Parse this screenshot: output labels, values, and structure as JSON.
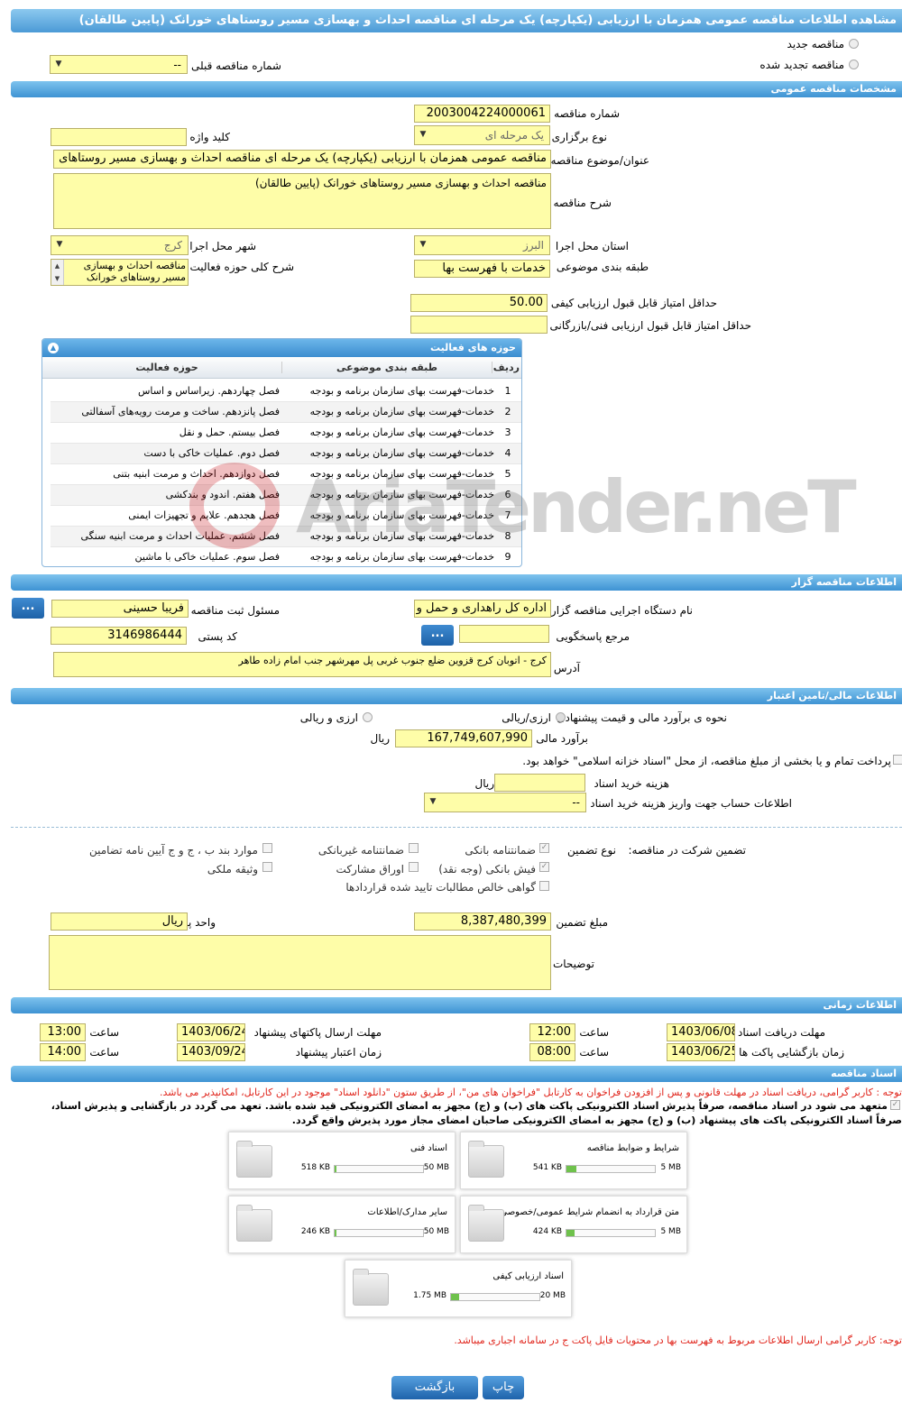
{
  "page_title": "مشاهده اطلاعات مناقصه عمومی همزمان با ارزیابی (یکپارچه) یک مرحله ای مناقصه احداث و بهسازی مسیر روستاهای خورانک (پایین طالقان)",
  "tender_type": {
    "new_label": "مناقصه جدید",
    "renewed_label": "مناقصه تجدید شده",
    "prev_label": "شماره مناقصه قبلی",
    "prev_value": "--"
  },
  "general": {
    "header": "مشخصات مناقصه عمومی",
    "number_label": "شماره مناقصه",
    "number": "2003004224000061",
    "type_label": "نوع برگزاری",
    "type": "یک مرحله ای",
    "keyword_label": "کلید واژه",
    "keyword": "",
    "title_label": "عنوان/موضوع مناقصه",
    "title": "مناقصه عمومی همزمان با ارزیابی (یکپارچه) یک مرحله ای مناقصه احداث و بهسازی مسیر روستاهای",
    "desc_label": "شرح مناقصه",
    "desc": "مناقصه احداث و بهسازی مسیر روستاهای خورانک (پایین طالقان)",
    "province_label": "استان محل اجرا",
    "province": "البرز",
    "city_label": "شهر محل اجرا",
    "city": "کرج",
    "category_label": "طبقه بندی موضوعی",
    "category": "خدمات با فهرست بها",
    "scope_label": "شرح کلی حوزه فعالیت",
    "scope_line1": "مناقصه احداث و بهسازی",
    "scope_line2": "مسیر روستاهای خورانک",
    "min_quality_label": "حداقل امتیاز قابل قبول ارزیابی کیفی",
    "min_quality": "50.00",
    "min_tech_label": "حداقل امتیاز قابل قبول ارزیابی فنی/بازرگانی",
    "min_tech": ""
  },
  "activities": {
    "title": "حوزه های فعالیت",
    "col_row": "ردیف",
    "col_cat": "طبقه بندی موضوعی",
    "col_area": "حوزه فعالیت",
    "rows": [
      {
        "n": "1",
        "cat": "خدمات-فهرست بهای سازمان برنامه و بودجه",
        "area": "فصل چهاردهم. زیراساس و اساس"
      },
      {
        "n": "2",
        "cat": "خدمات-فهرست بهای سازمان برنامه و بودجه",
        "area": "فصل پانزدهم. ساخت و مرمت رویه‌های آسفالتی"
      },
      {
        "n": "3",
        "cat": "خدمات-فهرست بهای سازمان برنامه و بودجه",
        "area": "فصل بیستم. حمل و نقل"
      },
      {
        "n": "4",
        "cat": "خدمات-فهرست بهای سازمان برنامه و بودجه",
        "area": "فصل دوم. عملیات خاکی با دست"
      },
      {
        "n": "5",
        "cat": "خدمات-فهرست بهای سازمان برنامه و بودجه",
        "area": "فصل دوازدهم. احداث و مرمت ابنیه بتنی"
      },
      {
        "n": "6",
        "cat": "خدمات-فهرست بهای سازمان برنامه و بودجه",
        "area": "فصل هفتم. اندود و بندکشی"
      },
      {
        "n": "7",
        "cat": "خدمات-فهرست بهای سازمان برنامه و بودجه",
        "area": "فصل هجدهم. علایم و تجهیزات ایمنی"
      },
      {
        "n": "8",
        "cat": "خدمات-فهرست بهای سازمان برنامه و بودجه",
        "area": "فصل ششم.  عملیات احداث و مرمت ابنیه سنگی"
      },
      {
        "n": "9",
        "cat": "خدمات-فهرست بهای سازمان برنامه و بودجه",
        "area": "فصل سوم. عملیات خاکی با ماشین"
      }
    ]
  },
  "watermark": "AriaTender.neT",
  "organizer": {
    "header": "اطلاعات مناقصه گزار",
    "org_label": "نام دستگاه اجرایی مناقصه گزار",
    "org": "اداره کل راهداری و حمل و نقل",
    "resp_label": "مسئول ثبت مناقصه",
    "resp": "فریبا حسینی",
    "ref_label": "مرجع پاسخگویی",
    "ref": "",
    "postal_label": "کد پستی",
    "postal": "3146986444",
    "addr_label": "آدرس",
    "addr": "کرج - اتوبان کرج قزوین ضلع جنوب غربی پل مهرشهر جنب امام زاده طاهر",
    "dots": "..."
  },
  "finance": {
    "header": "اطلاعات مالی/تامین اعتبار",
    "method_label": "نحوه ی برآورد مالی و قیمت پیشنهادی",
    "opt1": "ارزی/ریالی",
    "opt2": "ارزی و ریالی",
    "estimate_label": "برآورد مالی",
    "estimate": "167,749,607,990",
    "rial": "ریال",
    "islamic_text": "پرداخت تمام و یا بخشی از مبلغ مناقصه، از محل \"اسناد خزانه اسلامی\" خواهد بود.",
    "doc_fee_label": "هزینه خرید اسناد",
    "doc_fee": "",
    "doc_fee_unit": "ریال",
    "account_label": "اطلاعات حساب جهت واریز هزینه خرید اسناد",
    "account": "--"
  },
  "guarantee": {
    "label": "تضمین شرکت در مناقصه:",
    "type_label": "نوع تضمین",
    "opts": [
      "ضمانتنامه بانکی",
      "ضمانتنامه غیربانکی",
      "موارد بند ب ، ج و ج آیین نامه تضامین",
      "فیش بانکی (وجه نقد)",
      "اوراق مشارکت",
      "وثیقه ملکی",
      "گواهی خالص مطالبات تایید شده قراردادها"
    ],
    "amount_label": "مبلغ تضمین",
    "amount": "8,387,480,399",
    "currency_label": "واحد پول",
    "currency": "ریال",
    "notes_label": "توضیحات",
    "notes": ""
  },
  "timing": {
    "header": "اطلاعات زمانی",
    "receive_label": "مهلت دریافت اسناد",
    "receive_date": "1403/06/08",
    "receive_time": "12:00",
    "submit_label": "مهلت ارسال پاکتهای پیشنهاد",
    "submit_date": "1403/06/24",
    "submit_time": "13:00",
    "open_label": "زمان بازگشایی پاکت ها",
    "open_date": "1403/06/25",
    "open_time": "08:00",
    "validity_label": "زمان اعتبار پیشنهاد",
    "validity_date": "1403/09/24",
    "validity_time": "14:00",
    "time_label": "ساعت"
  },
  "documents": {
    "header": "اسناد مناقصه",
    "notice": "توجه : کاربر گرامی، دریافت اسناد در مهلت قانونی و پس از افزودن فراخوان به کارتابل \"فراخوان های من\"، از طریق ستون \"دانلود اسناد\" موجود در این کارتابل، امکانپذیر می باشد.",
    "commit_line1": "متعهد می شود در اسناد مناقصه، صرفاً پذیرش اسناد الکترونیکی پاکت های (ب) و (ج) مجهز به امضای الکترونیکی قید شده باشد. تعهد می گردد در بازگشایی و پذیرش اسناد،",
    "commit_line2": "صرفاً اسناد الکترونیکی پاکت های پیشنهاد (ب) و (ج) مجهز به امضای الکترونیکی صاحبان امضای مجاز مورد پذیرش واقع گردد.",
    "files": [
      {
        "name": "شرایط و ضوابط مناقصه",
        "size": "541 KB",
        "max": "5 MB",
        "fill": 0.11
      },
      {
        "name": "اسناد فنی",
        "size": "518 KB",
        "max": "50 MB",
        "fill": 0.02
      },
      {
        "name": "متن قرارداد به انضمام شرایط عمومی/خصوصی",
        "size": "424 KB",
        "max": "5 MB",
        "fill": 0.09
      },
      {
        "name": "سایر مدارک/اطلاعات",
        "size": "246 KB",
        "max": "50 MB",
        "fill": 0.01
      },
      {
        "name": "اسناد ارزیابی کیفی",
        "size": "1.75 MB",
        "max": "20 MB",
        "fill": 0.09
      }
    ],
    "final_note": "توجه: کاربر گرامی ارسال اطلاعات مربوط به فهرست بها در محتویات فایل پاکت ج در سامانه اجباری میباشد."
  },
  "buttons": {
    "back": "بازگشت",
    "print": "چاپ"
  }
}
